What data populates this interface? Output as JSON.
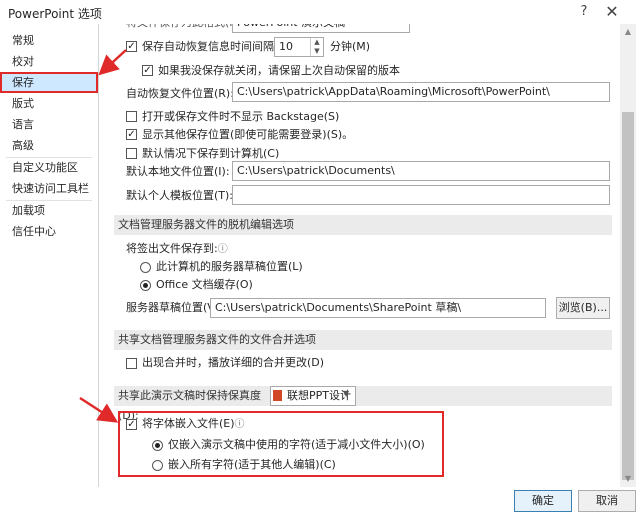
{
  "window": {
    "title": "PowerPoint 选项",
    "help_glyph": "?",
    "close_glyph": "✕"
  },
  "sidebar": {
    "items": [
      {
        "label": "常规"
      },
      {
        "label": "校对"
      },
      {
        "label": "保存"
      },
      {
        "label": "版式"
      },
      {
        "label": "语言"
      },
      {
        "label": "高级"
      },
      {
        "label": "自定义功能区"
      },
      {
        "label": "快速访问工具栏"
      },
      {
        "label": "加载项"
      },
      {
        "label": "信任中心"
      }
    ],
    "selected": "保存"
  },
  "save": {
    "top_partial_label": "将文件保存为此格式(F):",
    "top_partial_value": "PowerPoint 演示文稿",
    "autorecover_label": "保存自动恢复信息时间间隔(A)",
    "autorecover_checked": true,
    "autorecover_minutes": "10",
    "minutes_unit": "分钟(M)",
    "keep_last_label": "如果我没保存就关闭，请保留上次自动保留的版本",
    "keep_last_checked": true,
    "autorecover_location_label": "自动恢复文件位置(R):",
    "autorecover_location_value": "C:\\Users\\patrick\\AppData\\Roaming\\Microsoft\\PowerPoint\\",
    "no_backstage_label": "打开或保存文件时不显示 Backstage(S)",
    "no_backstage_checked": false,
    "show_other_locations_label": "显示其他保存位置(即使可能需要登录)(S)。",
    "show_other_locations_checked": true,
    "save_to_computer_label": "默认情况下保存到计算机(C)",
    "save_to_computer_checked": false,
    "default_local_label": "默认本地文件位置(I):",
    "default_local_value": "C:\\Users\\patrick\\Documents\\",
    "personal_templates_label": "默认个人模板位置(T):",
    "personal_templates_value": ""
  },
  "offline": {
    "section_title": "文档管理服务器文件的脱机编辑选项",
    "save_checked_out_label": "将签出文件保存到:",
    "info_glyph": "ⓘ",
    "option_server_drafts": "此计算机的服务器草稿位置(L)",
    "option_office_cache": "Office 文档缓存(O)",
    "selected_option": "Office 文档缓存(O)",
    "server_drafts_location_label": "服务器草稿位置(V):",
    "server_drafts_location_value": "C:\\Users\\patrick\\Documents\\SharePoint 草稿\\",
    "browse_button": "浏览(B)..."
  },
  "merge": {
    "section_title": "共享文档管理服务器文件的文件合并选项",
    "show_details_label": "出现合并时，播放详细的合并更改(D)",
    "show_details_checked": false
  },
  "fidelity": {
    "section_title": "共享此演示文稿时保持保真度(D):",
    "document_name": "联想PPT设计",
    "embed_fonts_label": "将字体嵌入文件(E)",
    "embed_fonts_checked": true,
    "option_used_chars": "仅嵌入演示文稿中使用的字符(适于减小文件大小)(O)",
    "option_all_chars": "嵌入所有字符(适于其他人编辑)(C)",
    "selected_option": "仅嵌入演示文稿中使用的字符(适于减小文件大小)(O)"
  },
  "footer": {
    "ok_button": "确定",
    "cancel_button": "取消"
  },
  "colors": {
    "annotation_red": "#e02a2a",
    "selected_nav_bg": "#cde8ff",
    "section_bg": "#ebebeb"
  }
}
